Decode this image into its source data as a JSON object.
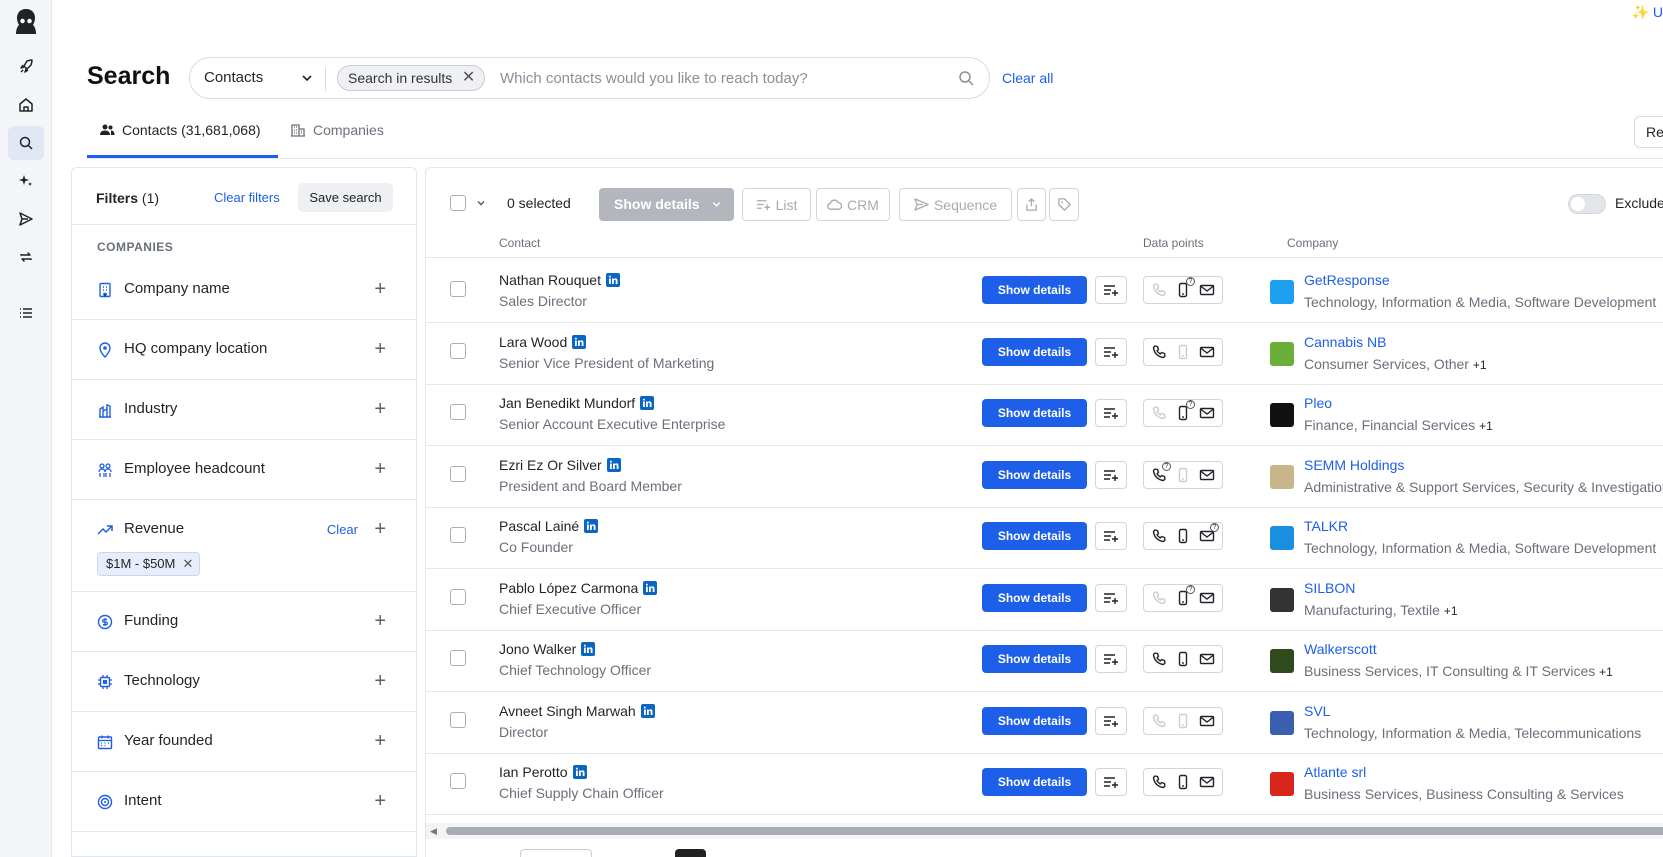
{
  "header": {
    "upgrade_label": "✨ U",
    "page_title": "Search",
    "search_type": "Contacts",
    "chip_label": "Search in results",
    "search_placeholder": "Which contacts would you like to reach today?",
    "clear_all": "Clear all",
    "tab_contacts": "Contacts (31,681,068)",
    "tab_companies": "Companies",
    "right_button": "Re"
  },
  "filters": {
    "title": "Filters",
    "count": "(1)",
    "clear_filters": "Clear filters",
    "save_search": "Save search",
    "section": "COMPANIES",
    "items": [
      {
        "label": "Company name",
        "icon": "building-icon"
      },
      {
        "label": "HQ company location",
        "icon": "location-pin-icon"
      },
      {
        "label": "Industry",
        "icon": "industry-icon"
      },
      {
        "label": "Employee headcount",
        "icon": "people-icon"
      },
      {
        "label": "Revenue",
        "icon": "trending-up-icon",
        "clear": "Clear",
        "chip": "$1M - $50M"
      },
      {
        "label": "Funding",
        "icon": "dollar-icon"
      },
      {
        "label": "Technology",
        "icon": "chip-icon"
      },
      {
        "label": "Year founded",
        "icon": "calendar-icon"
      },
      {
        "label": "Intent",
        "icon": "target-icon"
      }
    ]
  },
  "toolbar": {
    "selected": "0 selected",
    "show_details": "Show details",
    "list": "List",
    "crm": "CRM",
    "sequence": "Sequence",
    "exclude": "Exclude"
  },
  "columns": {
    "contact": "Contact",
    "data_points": "Data points",
    "company": "Company"
  },
  "row_button": "Show details",
  "rows": [
    {
      "name": "Nathan Rouquet",
      "title": "Sales Director",
      "company": "GetResponse",
      "industry": "Technology, Information & Media, Software Development",
      "more": "",
      "logo_color": "#1ea0f0",
      "phone": "dim",
      "mobile": "q",
      "email": "on"
    },
    {
      "name": "Lara Wood",
      "title": "Senior Vice President of Marketing",
      "company": "Cannabis NB",
      "industry": "Consumer Services, Other",
      "more": "+1",
      "logo_color": "#6cae3a",
      "phone": "on",
      "mobile": "dim",
      "email": "on"
    },
    {
      "name": "Jan Benedikt Mundorf",
      "title": "Senior Account Executive Enterprise",
      "company": "Pleo",
      "industry": "Finance, Financial Services",
      "more": "+1",
      "logo_color": "#111111",
      "phone": "dim",
      "mobile": "q",
      "email": "on"
    },
    {
      "name": "Ezri Ez Or Silver",
      "title": "President and Board Member",
      "company": "SEMM Holdings",
      "industry": "Administrative & Support Services, Security & Investigations",
      "more": "",
      "logo_color": "#c9b58a",
      "phone": "q",
      "mobile": "dim",
      "email": "on"
    },
    {
      "name": "Pascal Lainé",
      "title": "Co Founder",
      "company": "TALKR",
      "industry": "Technology, Information & Media, Software Development",
      "more": "",
      "logo_color": "#1a8fe0",
      "phone": "on",
      "mobile": "on",
      "email": "q"
    },
    {
      "name": "Pablo López Carmona",
      "title": "Chief Executive Officer",
      "company": "SILBON",
      "industry": "Manufacturing, Textile",
      "more": "+1",
      "logo_color": "#333333",
      "phone": "dim",
      "mobile": "q",
      "email": "on"
    },
    {
      "name": "Jono Walker",
      "title": "Chief Technology Officer",
      "company": "Walkerscott",
      "industry": "Business Services, IT Consulting & IT Services",
      "more": "+1",
      "logo_color": "#2f4a1c",
      "phone": "on",
      "mobile": "on",
      "email": "on"
    },
    {
      "name": "Avneet Singh Marwah",
      "title": "Director",
      "company": "SVL",
      "industry": "Technology, Information & Media, Telecommunications",
      "more": "",
      "logo_color": "#3a5fb0",
      "phone": "dim",
      "mobile": "dim",
      "email": "on"
    },
    {
      "name": "Ian Perotto",
      "title": "Chief Supply Chain Officer",
      "company": "Atlante srl",
      "industry": "Business Services, Business Consulting & Services",
      "more": "",
      "logo_color": "#d9261c",
      "phone": "on",
      "mobile": "on",
      "email": "on"
    }
  ]
}
